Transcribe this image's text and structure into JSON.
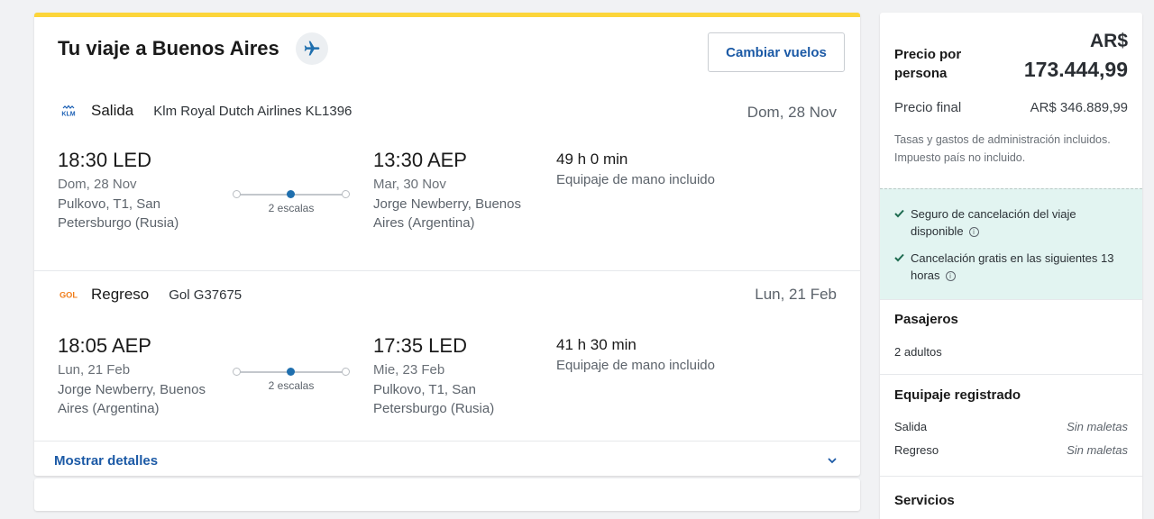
{
  "trip": {
    "title": "Tu viaje a Buenos Aires",
    "change_button": "Cambiar vuelos",
    "details_link": "Mostrar detalles"
  },
  "outbound": {
    "type": "Salida",
    "airline_logo": "KLM",
    "flight": "Klm Royal Dutch Airlines KL1396",
    "date": "Dom, 28 Nov",
    "dep_time": "18:30 LED",
    "dep_date": "Dom, 28 Nov",
    "dep_place": "Pulkovo, T1, San Petersburgo (Rusia)",
    "stops": "2 escalas",
    "arr_time": "13:30 AEP",
    "arr_date": "Mar, 30 Nov",
    "arr_place": "Jorge Newberry, Buenos Aires (Argentina)",
    "duration": "49 h 0 min",
    "baggage": "Equipaje de mano incluido"
  },
  "return": {
    "type": "Regreso",
    "airline_logo": "GOL",
    "flight": "Gol G37675",
    "date": "Lun, 21 Feb",
    "dep_time": "18:05 AEP",
    "dep_date": "Lun, 21 Feb",
    "dep_place": "Jorge Newberry, Buenos Aires (Argentina)",
    "stops": "2 escalas",
    "arr_time": "17:35 LED",
    "arr_date": "Mie, 23 Feb",
    "arr_place": "Pulkovo, T1, San Petersburgo (Rusia)",
    "duration": "41 h 30 min",
    "baggage": "Equipaje de mano incluido"
  },
  "price": {
    "per_person_label": "Precio por persona",
    "currency": "AR$",
    "per_person_amount": "173.444,99",
    "final_label": "Precio final",
    "final_value": "AR$ 346.889,99",
    "tax_note": "Tasas y gastos de administración incluidos. Impuesto país no incluido."
  },
  "insurance": {
    "items": [
      "Seguro de cancelación del viaje disponible",
      "Cancelación gratis en las siguientes 13 horas"
    ]
  },
  "passengers": {
    "title": "Pasajeros",
    "value": "2 adultos"
  },
  "baggage_section": {
    "title": "Equipaje registrado",
    "rows": [
      {
        "label": "Salida",
        "value": "Sin maletas"
      },
      {
        "label": "Regreso",
        "value": "Sin maletas"
      }
    ]
  },
  "services": {
    "title": "Servicios"
  },
  "colors": {
    "accent_yellow": "#fcd53a",
    "link_blue": "#1c5aa6",
    "insurance_bg": "#e2f4f1",
    "check_green": "#1e6b50"
  }
}
